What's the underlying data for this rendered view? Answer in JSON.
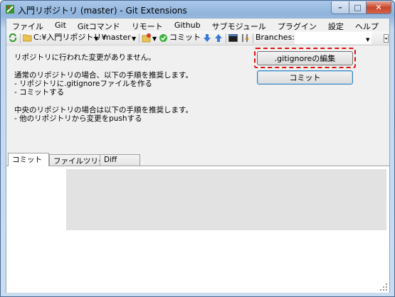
{
  "window": {
    "title": "入門リポジトリ (master) - Git Extensions",
    "caption_min": "–",
    "caption_max": "□",
    "caption_close": "✕"
  },
  "menu": [
    "ファイル",
    "Git",
    "Gitコマンド",
    "リモート",
    "Github",
    "サブモジュール",
    "プラグイン",
    "設定",
    "ヘルプ"
  ],
  "toolbar": {
    "repo_path": "C:¥入門リポジトリ¥",
    "branch": "master",
    "commit_label": "コミット",
    "branches_label": "Branches:",
    "branches_value": ""
  },
  "status": {
    "line1": "リポジトリに行われた変更がありません。",
    "line2": "通常のリポジトリの場合、以下の手順を推奨します。",
    "line3": "- リポジトリに.gitignoreファイルを作る",
    "line4": "- コミットする",
    "line5": "中央のリポジトリの場合は以下の手順を推奨します。",
    "line6": "- 他のリポジトリから変更をpushする"
  },
  "buttons": {
    "edit_gitignore": ".gitignoreの編集",
    "commit": "コミット"
  },
  "tabs": [
    "コミット",
    "ファイルツリー",
    "Diff"
  ],
  "colors": {
    "highlight": "#e01010",
    "title_gradient": "#8fb3dc"
  }
}
